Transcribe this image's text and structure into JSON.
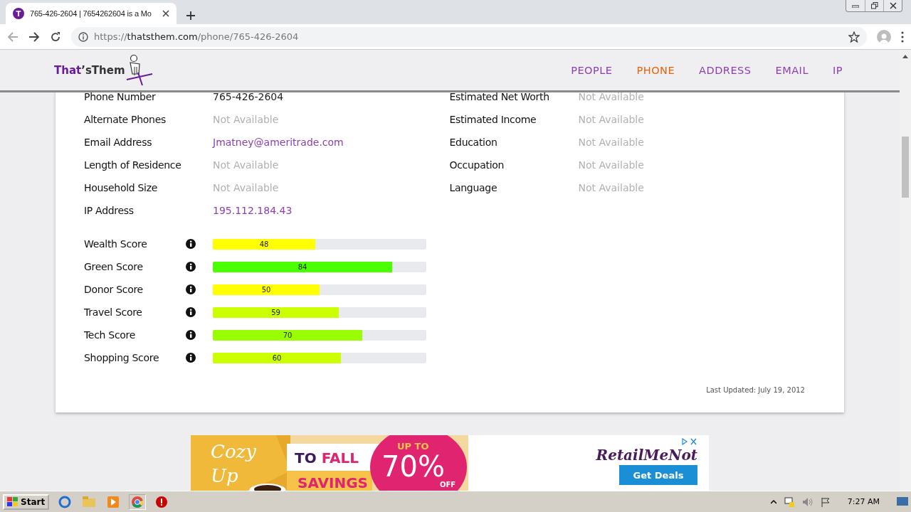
{
  "browser": {
    "tab": {
      "favicon_letter": "T",
      "title": "765-426-2604 | 7654262604 is a Mo"
    },
    "url": {
      "scheme": "https://",
      "host": "thatsthem.com",
      "path": "/phone/765-426-2604"
    }
  },
  "site": {
    "logo": {
      "first": "That",
      "second": "’sThem"
    },
    "nav": [
      {
        "label": "PEOPLE",
        "selected": false
      },
      {
        "label": "PHONE",
        "selected": true
      },
      {
        "label": "ADDRESS",
        "selected": false
      },
      {
        "label": "EMAIL",
        "selected": false
      },
      {
        "label": "IP",
        "selected": false
      }
    ]
  },
  "details_left": [
    {
      "label": "Phone Number",
      "value": "765-426-2604",
      "kind": "plain"
    },
    {
      "label": "Alternate Phones",
      "value": "Not Available",
      "kind": "missing"
    },
    {
      "label": "Email Address",
      "value": "Jmatney@ameritrade.com",
      "kind": "link"
    },
    {
      "label": "Length of Residence",
      "value": "Not Available",
      "kind": "missing"
    },
    {
      "label": "Household Size",
      "value": "Not Available",
      "kind": "missing"
    },
    {
      "label": "IP Address",
      "value": "195.112.184.43",
      "kind": "link"
    }
  ],
  "details_right": [
    {
      "label": "Estimated Net Worth",
      "value": "Not Available",
      "kind": "missing"
    },
    {
      "label": "Estimated Income",
      "value": "Not Available",
      "kind": "missing"
    },
    {
      "label": "Education",
      "value": "Not Available",
      "kind": "missing"
    },
    {
      "label": "Occupation",
      "value": "Not Available",
      "kind": "missing"
    },
    {
      "label": "Language",
      "value": "Not Available",
      "kind": "missing"
    }
  ],
  "scores": [
    {
      "label": "Wealth Score",
      "reading": "48",
      "level": 0.48,
      "color": "#ffff00"
    },
    {
      "label": "Green Score",
      "reading": "84",
      "level": 0.84,
      "color": "#4cff00"
    },
    {
      "label": "Donor Score",
      "reading": "50",
      "level": 0.5,
      "color": "#ffff00"
    },
    {
      "label": "Travel Score",
      "reading": "59",
      "level": 0.59,
      "color": "#ccff00"
    },
    {
      "label": "Tech Score",
      "reading": "70",
      "level": 0.7,
      "color": "#99ff00"
    },
    {
      "label": "Shopping Score",
      "reading": "60",
      "level": 0.6,
      "color": "#ccff00"
    }
  ],
  "last_updated": "Last Updated: July 19, 2012",
  "ad": {
    "script": "Cozy Up",
    "line1_dark": "TO",
    "line1_pink": "FALL",
    "line2": "SAVINGS",
    "up_to": "UP TO",
    "percent": "70%",
    "off": "OFF",
    "brand": "RetailMeNot",
    "button": "Get Deals"
  },
  "taskbar": {
    "start": "Start",
    "time": "7:27 AM"
  }
}
